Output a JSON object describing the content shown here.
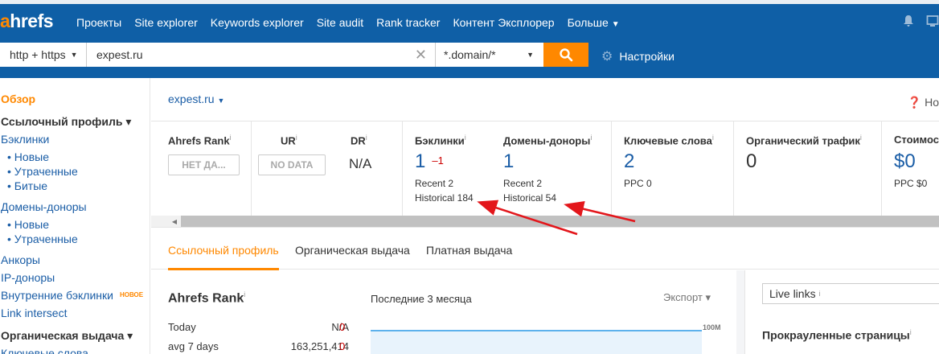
{
  "app": {
    "logo_a": "a",
    "logo_rest": "hrefs",
    "nav": [
      "Проекты",
      "Site explorer",
      "Keywords explorer",
      "Site audit",
      "Rank tracker",
      "Контент Эксплорер",
      "Больше"
    ],
    "icons": [
      "bell-icon",
      "monitor-icon"
    ]
  },
  "search": {
    "protocol": "http + https",
    "domain": "expest.ru",
    "mode": "*.domain/*",
    "settings_label": "Настройки"
  },
  "sidebar": {
    "overview": "Обзор",
    "link_profile": "Ссылочный профиль ▾",
    "backlinks": "Бэклинки",
    "backlinks_new": "• Новые",
    "backlinks_lost": "• Утраченные",
    "backlinks_broken": "• Битые",
    "ref_domains": "Домены-доноры",
    "ref_new": "• Новые",
    "ref_lost": "• Утраченные",
    "anchors": "Анкоры",
    "ip": "IP-доноры",
    "internal": "Внутренние бэклинки",
    "internal_badge": "НОВОЕ",
    "intersect": "Link intersect",
    "organic": "Органическая выдача ▾",
    "keywords": "Ключевые слова"
  },
  "main": {
    "target": "expest.ru",
    "help": "Но",
    "metrics": {
      "ahrefs_rank": "Ahrefs Rank",
      "ahrefs_rank_value": "НЕТ ДА...",
      "ur": "UR",
      "ur_value": "NO DATA",
      "dr": "DR",
      "dr_value": "N/A",
      "backlinks": "Бэклинки",
      "backlinks_value": "1",
      "backlinks_delta": "–1",
      "backlinks_recent": "Recent 2",
      "backlinks_hist": "Historical 184",
      "refdomains": "Домены-доноры",
      "refdomains_value": "1",
      "refdomains_recent": "Recent 2",
      "refdomains_hist": "Historical 54",
      "keywords": "Ключевые слова",
      "keywords_value": "2",
      "keywords_ppc": "PPC 0",
      "traffic": "Органический трафик",
      "traffic_value": "0",
      "cost": "Стоимос",
      "cost_value": "$0",
      "cost_ppc": "PPC $0",
      "info": "i"
    },
    "tabs": [
      "Ссылочный профиль",
      "Органическая выдача",
      "Платная выдача"
    ],
    "ahrefs_rank_block": {
      "title": "Ahrefs Rank",
      "rows": [
        {
          "label": "Today",
          "value": "N/A",
          "delta": "0"
        },
        {
          "label": "avg 7 days",
          "value": "163,251,414",
          "delta": "0"
        }
      ]
    },
    "period": "Последние 3 месяца",
    "export": "Экспорт ▾",
    "chart_ymax": "100M",
    "live_links": "Live links",
    "crawled_pages": "Прокрауленные страницы"
  }
}
